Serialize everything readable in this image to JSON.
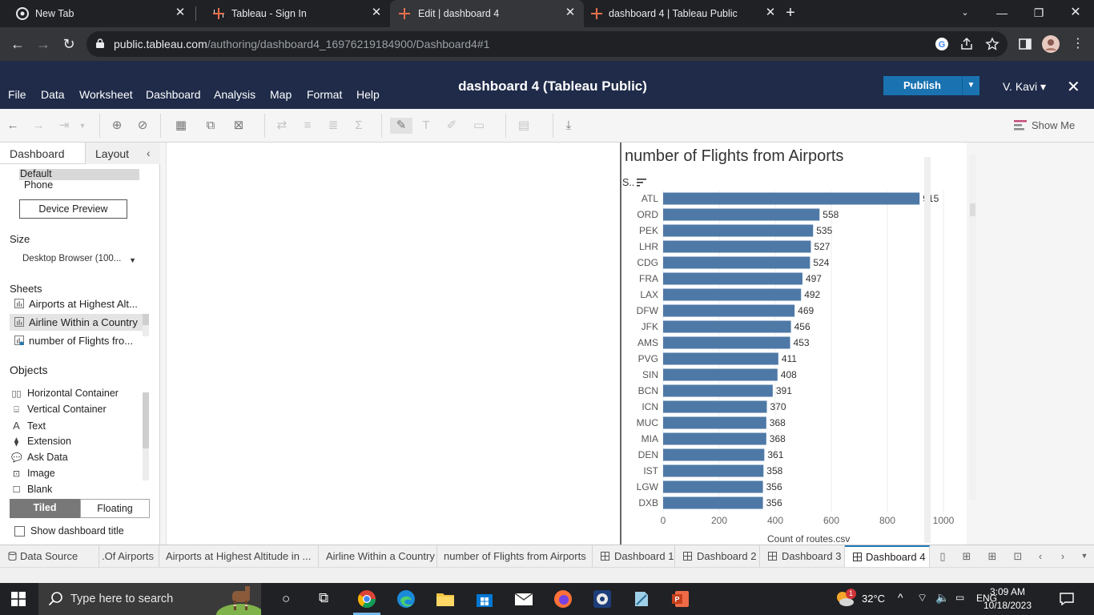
{
  "browser": {
    "tabs": [
      {
        "title": "New Tab",
        "icon": "chrome-icon"
      },
      {
        "title": "Tableau - Sign In",
        "icon": "tableau-icon"
      },
      {
        "title": "Edit | dashboard 4",
        "icon": "tableau-icon",
        "active": true
      },
      {
        "title": "dashboard 4 | Tableau Public",
        "icon": "tableau-icon"
      }
    ],
    "url_host": "public.tableau.com",
    "url_path": "/authoring/dashboard4_16976219184900/Dashboard4#1"
  },
  "app": {
    "title": "dashboard 4 (Tableau Public)",
    "menu": [
      "File",
      "Data",
      "Worksheet",
      "Dashboard",
      "Analysis",
      "Map",
      "Format",
      "Help"
    ],
    "publish_label": "Publish",
    "user": "V. Kavi ▾",
    "show_me": "Show Me",
    "colors": {
      "header": "#1f2b49",
      "publish": "#1a73b0",
      "bar": "#4e79a7",
      "active_tab_accent": "#1f77b4"
    }
  },
  "left_panel": {
    "tab_dashboard": "Dashboard",
    "tab_layout": "Layout",
    "device_default": "Default",
    "device_phone": "Phone",
    "device_preview": "Device Preview",
    "size_heading": "Size",
    "size_value": "Desktop Browser (100...",
    "sheets_heading": "Sheets",
    "sheets": [
      "Airports at Highest Alt...",
      "Airline Within a Country",
      "number of Flights fro..."
    ],
    "objects_heading": "Objects",
    "objects": [
      {
        "label": "Horizontal Container",
        "icon": "horizontal-container-icon"
      },
      {
        "label": "Vertical Container",
        "icon": "vertical-container-icon"
      },
      {
        "label": "Text",
        "icon": "text-icon"
      },
      {
        "label": "Extension",
        "icon": "extension-icon"
      },
      {
        "label": "Ask Data",
        "icon": "ask-data-icon"
      },
      {
        "label": "Image",
        "icon": "image-icon"
      },
      {
        "label": "Blank",
        "icon": "blank-icon"
      }
    ],
    "tiled": "Tiled",
    "floating": "Floating",
    "show_title": "Show dashboard title"
  },
  "chart_data": {
    "type": "bar",
    "orientation": "horizontal",
    "title": "number of Flights from Airports",
    "row_header": "S..",
    "xlabel": "Count of routes.csv",
    "xlim": [
      0,
      1000
    ],
    "xticks": [
      0,
      200,
      400,
      600,
      800,
      1000
    ],
    "grid": true,
    "categories": [
      "ATL",
      "ORD",
      "PEK",
      "LHR",
      "CDG",
      "FRA",
      "LAX",
      "DFW",
      "JFK",
      "AMS",
      "PVG",
      "SIN",
      "BCN",
      "ICN",
      "MUC",
      "MIA",
      "DEN",
      "IST",
      "LGW",
      "DXB"
    ],
    "values": [
      915,
      558,
      535,
      527,
      524,
      497,
      492,
      469,
      456,
      453,
      411,
      408,
      391,
      370,
      368,
      368,
      361,
      358,
      356,
      356
    ]
  },
  "sheet_tabs": {
    "data_source": "Data Source",
    "tabs": [
      ".Of Airports",
      "Airports at Highest Altitude in ...",
      "Airline Within a Country",
      "number of Flights from Airports",
      "Dashboard 1",
      "Dashboard 2",
      "Dashboard 3",
      "Dashboard 4"
    ]
  },
  "taskbar": {
    "search_placeholder": "Type here to search",
    "weather": "32°C",
    "language": "ENG",
    "time": "3:09 AM",
    "date": "10/18/2023",
    "weather_badge": "1"
  }
}
